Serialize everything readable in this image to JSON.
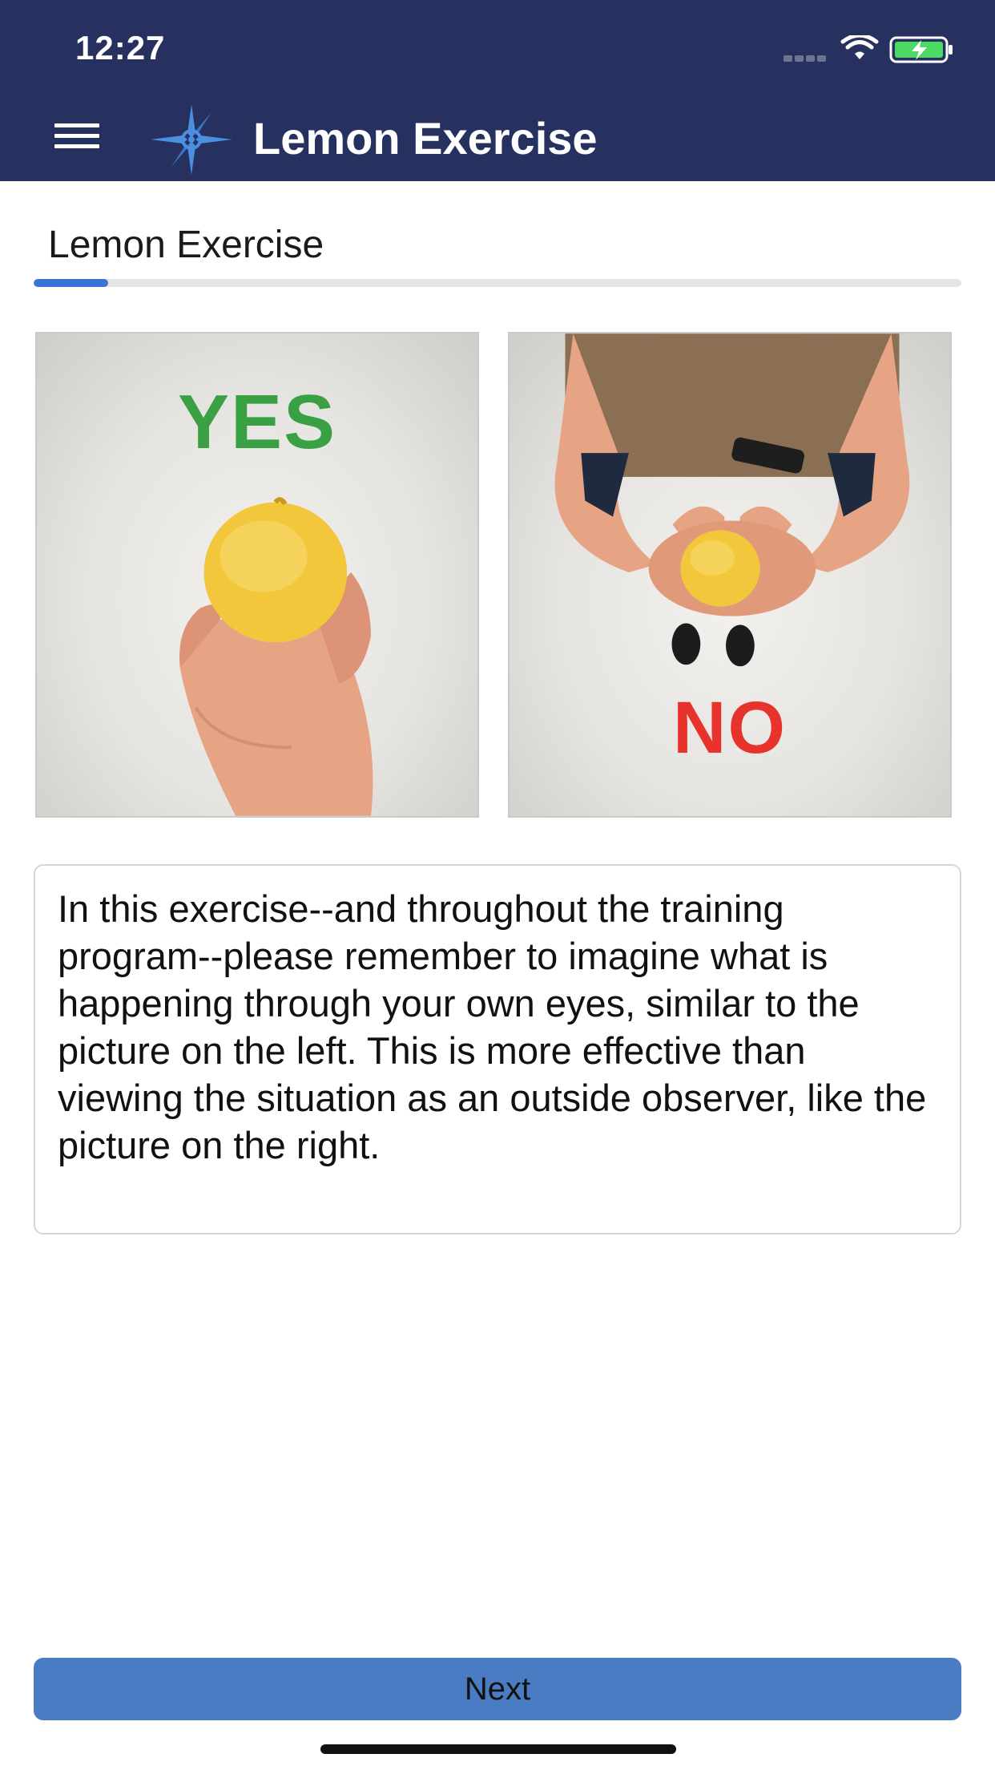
{
  "status_bar": {
    "time": "12:27",
    "icons": [
      "signal-dots-icon",
      "wifi-icon",
      "battery-charging-icon"
    ]
  },
  "header": {
    "menu_icon": "hamburger-menu-icon",
    "logo_icon": "compass-star-logo-icon",
    "title": "Lemon Exercise"
  },
  "page": {
    "title": "Lemon Exercise",
    "progress_percent": 8
  },
  "images": {
    "left": {
      "overlay_label": "YES",
      "label_color": "#3aa044"
    },
    "right": {
      "overlay_label": "NO",
      "label_color": "#e8332d"
    }
  },
  "instructions": {
    "text": "In this exercise--and throughout the training program--please remember to imagine what is happening through your own eyes, similar to the picture on the left. This is more effective than viewing the situation as an outside observer, like the picture on the right."
  },
  "footer": {
    "next_label": "Next"
  },
  "colors": {
    "header_bg": "#27315f",
    "accent": "#3b73d6",
    "button_bg": "#4a7cc4"
  }
}
